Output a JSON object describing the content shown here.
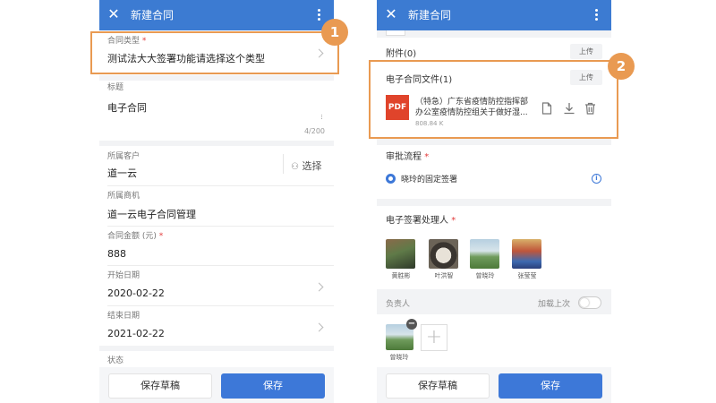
{
  "left": {
    "header": {
      "title": "新建合同"
    },
    "contract_type": {
      "label": "合同类型",
      "required_mark": "*",
      "value": "测试法大大签署功能请选择这个类型"
    },
    "title_field": {
      "label": "标题",
      "value": "电子合同",
      "counter": "4/200"
    },
    "customer": {
      "label": "所属客户",
      "value": "道一云",
      "select_label": "选择"
    },
    "opportunity": {
      "label": "所属商机",
      "value": "道一云电子合同管理"
    },
    "amount": {
      "label": "合同金额 (元)",
      "required_mark": "*",
      "value": "888"
    },
    "start_date": {
      "label": "开始日期",
      "value": "2020-02-22"
    },
    "end_date": {
      "label": "结束日期",
      "value": "2021-02-22"
    },
    "status": {
      "label": "状态"
    },
    "footer": {
      "draft_label": "保存草稿",
      "save_label": "保存"
    },
    "badge": "1"
  },
  "right": {
    "header": {
      "title": "新建合同"
    },
    "attachments": {
      "label": "附件(0)",
      "upload_label": "上传"
    },
    "e_contract": {
      "label": "电子合同文件(1)",
      "upload_label": "上传",
      "file": {
        "type_label": "PDF",
        "name_line1": "（特急）广东省疫情防控指挥部",
        "name_line2": "办公室疫情防控组关于做好湿...",
        "size": "808.84 K"
      }
    },
    "approval": {
      "label": "审批流程",
      "required_mark": "*",
      "option": "晓玲的固定签署"
    },
    "signers": {
      "label": "电子签署处理人",
      "required_mark": "*",
      "people": [
        {
          "name": "黄胜彬"
        },
        {
          "name": "叶洪智"
        },
        {
          "name": "曾晓玲"
        },
        {
          "name": "张莹莹"
        }
      ]
    },
    "owner": {
      "label": "负责人",
      "load_last_label": "加载上次",
      "person": "曾晓玲"
    },
    "footer": {
      "draft_label": "保存草稿",
      "save_label": "保存"
    },
    "badge": "2"
  },
  "colors": {
    "header": "#3c7bd2",
    "accent": "#3d78d8",
    "callout": "#e99a52",
    "required": "#e23b3b",
    "pdf": "#e0442b"
  }
}
